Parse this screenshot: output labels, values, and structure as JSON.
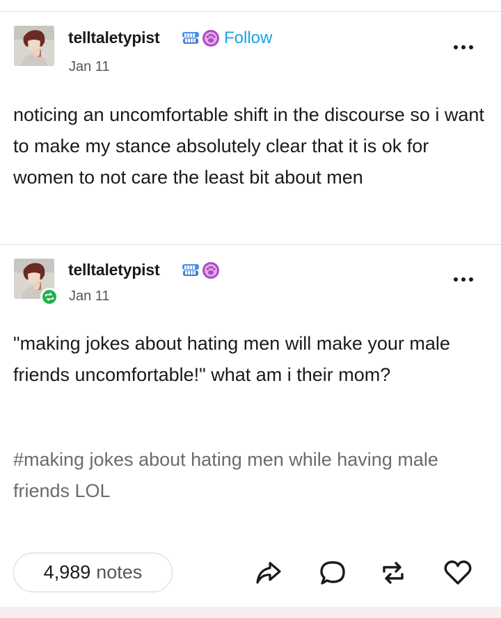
{
  "post1": {
    "username": "telltaletypist",
    "follow_label": "Follow",
    "date": "Jan 11",
    "body": "noticing an uncomfortable shift in the discourse so i want to make my stance absolutely clear that it is ok for women to not care the least bit about men"
  },
  "post2": {
    "username": "telltaletypist",
    "date": "Jan 11",
    "body": "\"making jokes about hating men will make your male friends uncomfortable!\" what am i their mom?",
    "tags": "#making jokes about hating men while having male friends LOL"
  },
  "footer": {
    "notes_count": "4,989",
    "notes_label": "notes"
  },
  "icons": {
    "badge1": "blue-teeth-badge-icon",
    "badge2": "purple-paw-badge-icon",
    "reblog": "reblog-icon",
    "share": "share-icon",
    "reply": "reply-icon",
    "like": "heart-icon",
    "more": "more-dots-icon"
  },
  "colors": {
    "follow": "#1da1e6",
    "reblog_badge": "#23b14d",
    "tags": "#6b6b6b"
  }
}
